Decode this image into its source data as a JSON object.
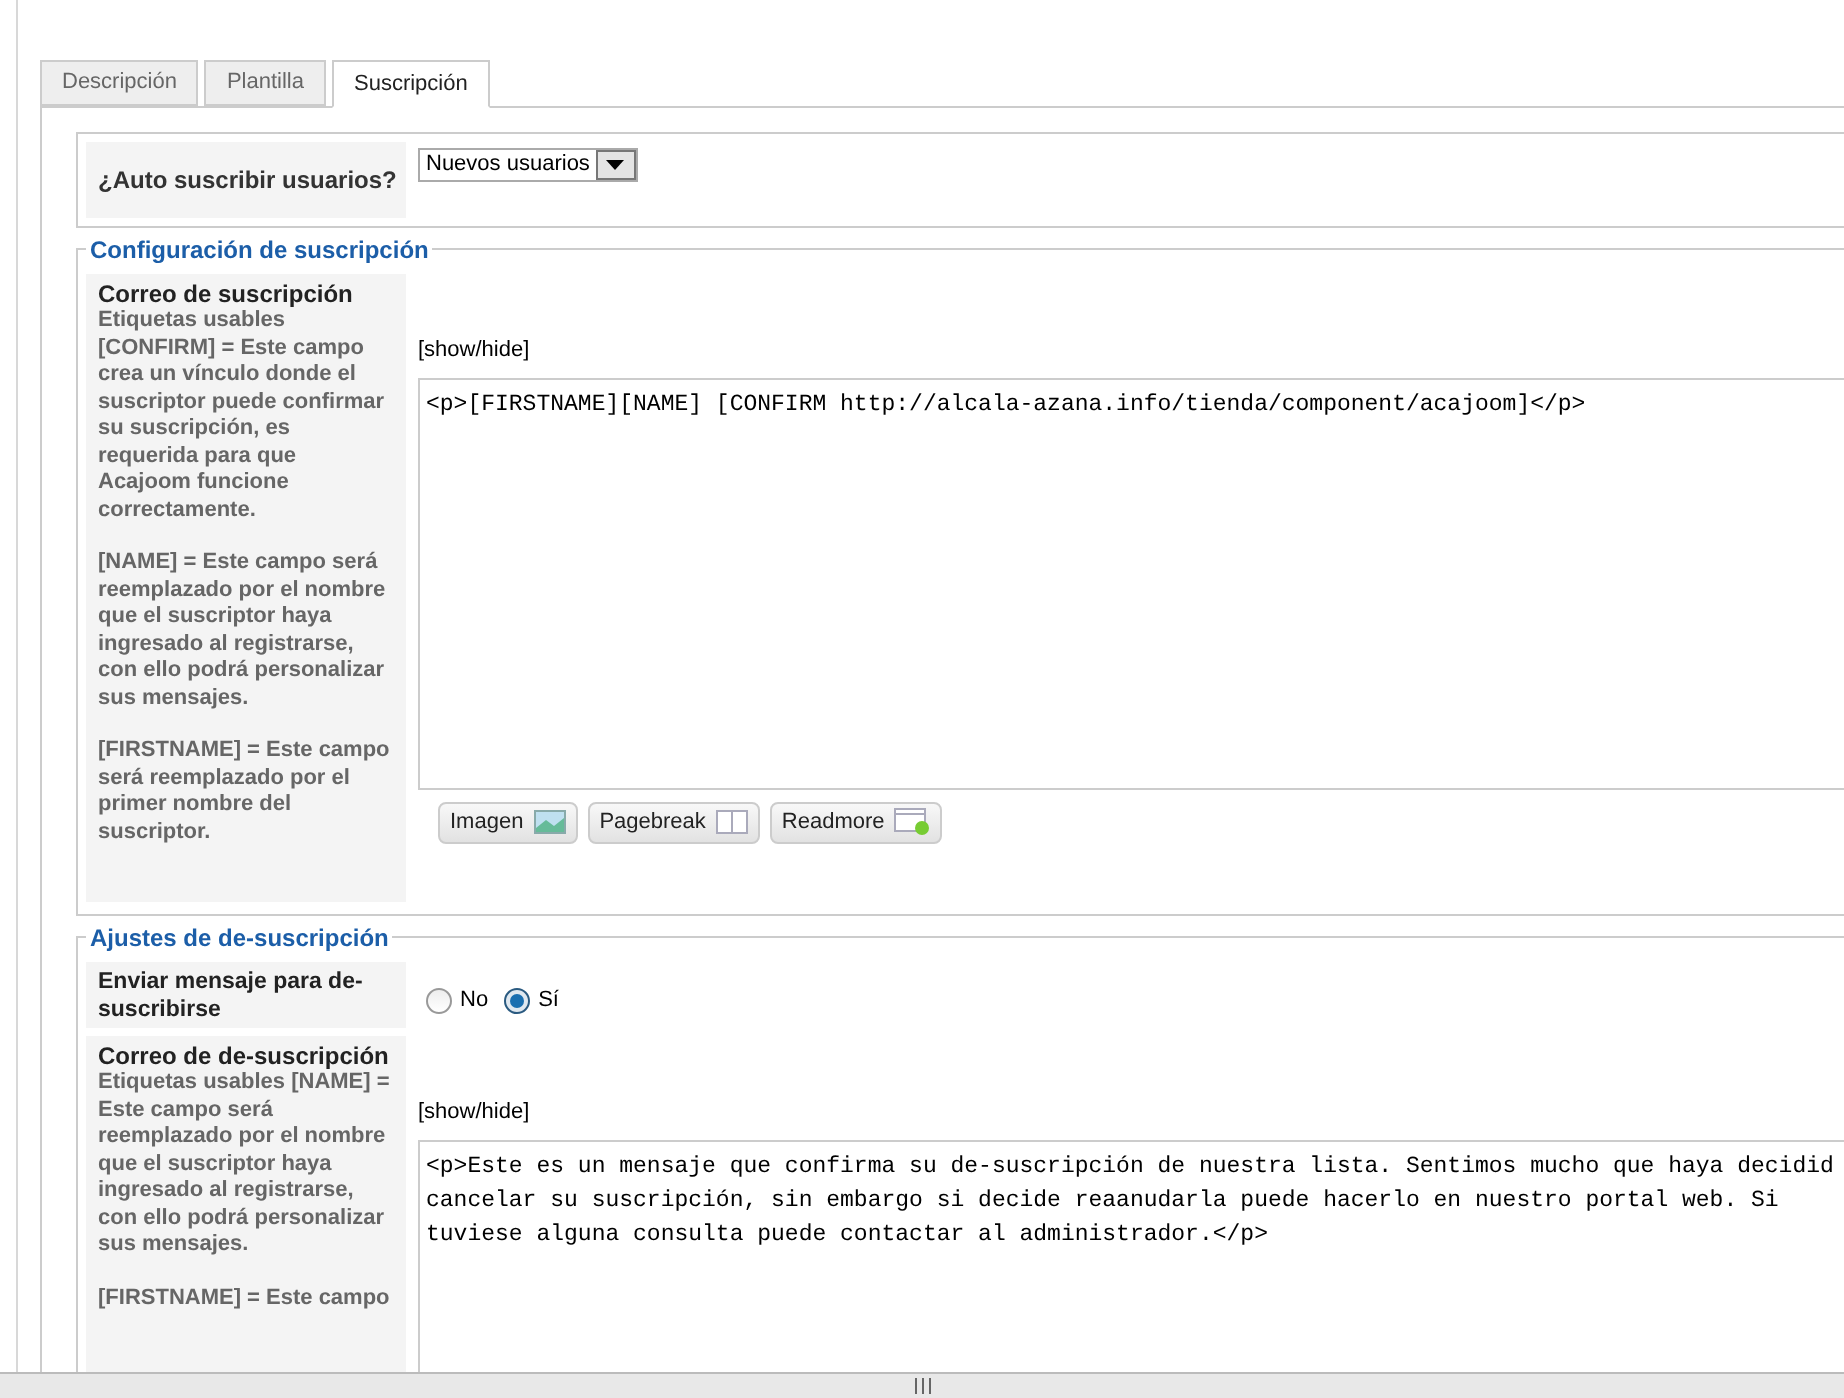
{
  "tabs": [
    {
      "label": "Descripción",
      "selected": false
    },
    {
      "label": "Plantilla",
      "selected": false
    },
    {
      "label": "Suscripción",
      "selected": true
    }
  ],
  "auto_subscribe": {
    "label": "¿Auto suscribir usuarios?",
    "value": "Nuevos usuarios"
  },
  "subscription_settings": {
    "legend": "Configuración de suscripción",
    "email": {
      "title": "Correo de suscripción",
      "help": [
        "Etiquetas usables [CONFIRM] = Este campo crea un vínculo donde el suscriptor puede confirmar su suscripción, es requerida para que Acajoom funcione correctamente.",
        "[NAME] = Este campo será reemplazado por el nombre que el suscriptor haya ingresado al registrarse, con ello podrá personalizar sus mensajes.",
        "[FIRSTNAME] = Este campo será reemplazado por el primer nombre del suscriptor."
      ],
      "toggle": "[show/hide]",
      "content_lines": [
        "<p>[FIRSTNAME][NAME] [CONFIRM http://alcala-azana.info/tienda/component/acajoom]</p>"
      ],
      "buttons": [
        {
          "label": "Imagen",
          "kind": "image"
        },
        {
          "label": "Pagebreak",
          "kind": "pagebreak"
        },
        {
          "label": "Readmore",
          "kind": "readmore"
        }
      ]
    }
  },
  "unsubscribe_settings": {
    "legend": "Ajustes de de-suscripción",
    "send_message": {
      "label": "Enviar mensaje para de-suscribirse",
      "options": [
        {
          "label": "No",
          "selected": false
        },
        {
          "label": "Sí",
          "selected": true
        }
      ]
    },
    "email": {
      "title": "Correo de de-suscripción",
      "help": [
        "Etiquetas usables [NAME] = Este campo será reemplazado por el nombre que el suscriptor haya ingresado al registrarse, con ello podrá personalizar sus mensajes.",
        "[FIRSTNAME] = Este campo"
      ],
      "toggle": "[show/hide]",
      "content_lines": [
        "<p>Este es un mensaje que confirma su de-suscripción de nuestra lista. Sentimos mucho que haya decidid",
        "cancelar su suscripción, sin embargo si decide reaanudarla puede hacerlo en nuestro portal web. Si",
        "tuviese alguna consulta puede contactar al administrador.</p>"
      ]
    }
  }
}
